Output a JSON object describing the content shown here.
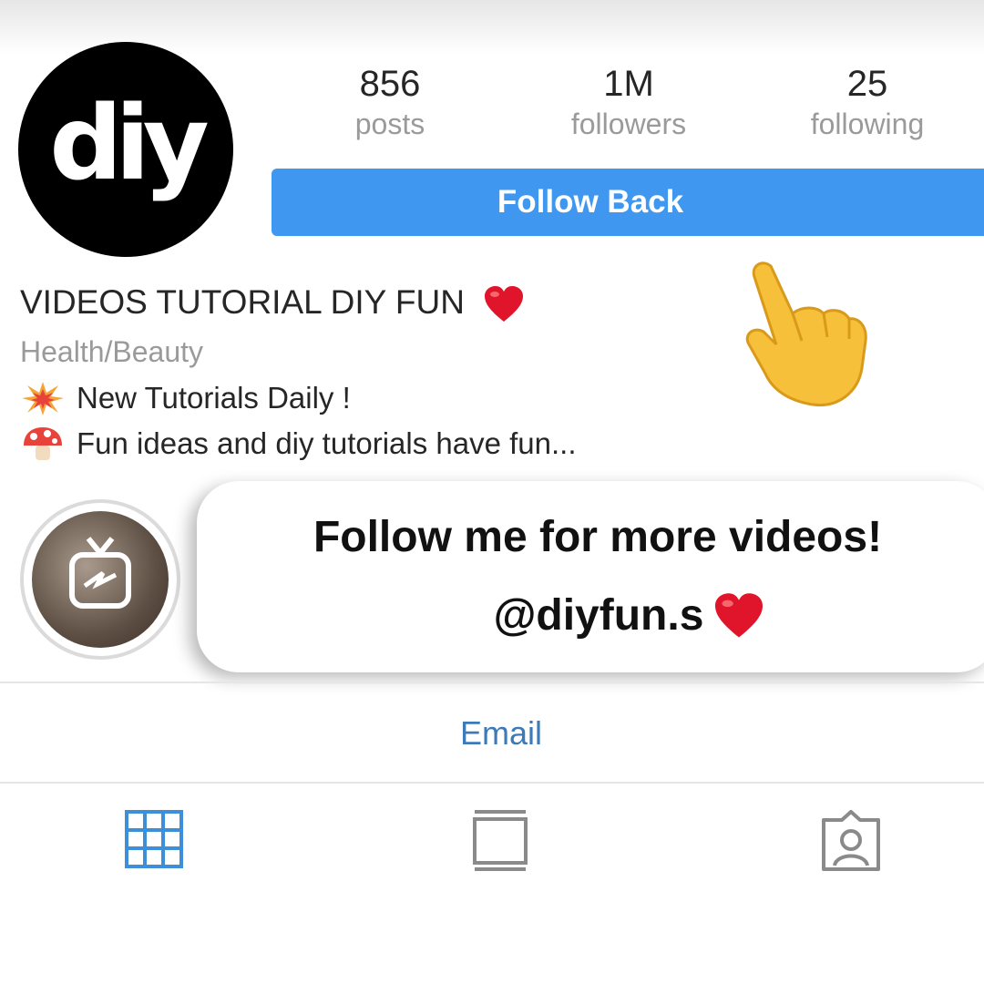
{
  "profile": {
    "avatar_text": "diy",
    "stats": {
      "posts": {
        "value": "856",
        "label": "posts"
      },
      "followers": {
        "value": "1M",
        "label": "followers"
      },
      "following": {
        "value": "25",
        "label": "following"
      }
    },
    "follow_button_label": "Follow Back",
    "name": "VIDEOS TUTORIAL DIY FUN",
    "category": "Health/Beauty",
    "bio": [
      {
        "icon": "collision-icon",
        "text": "New Tutorials Daily !"
      },
      {
        "icon": "mushroom-icon",
        "text": "Fun ideas and diy tutorials have fun..."
      }
    ],
    "contact_link": "Email"
  },
  "overlay": {
    "line1": "Follow me for more videos!",
    "line2": "@diyfun.s"
  },
  "tabs": [
    {
      "icon": "grid-icon",
      "active": true
    },
    {
      "icon": "feed-icon",
      "active": false
    },
    {
      "icon": "tagged-icon",
      "active": false
    }
  ],
  "colors": {
    "accent_blue": "#3f97f0",
    "link_blue": "#3c7ab8",
    "heart_red": "#e0142a",
    "muted_gray": "#9a9a9a"
  }
}
